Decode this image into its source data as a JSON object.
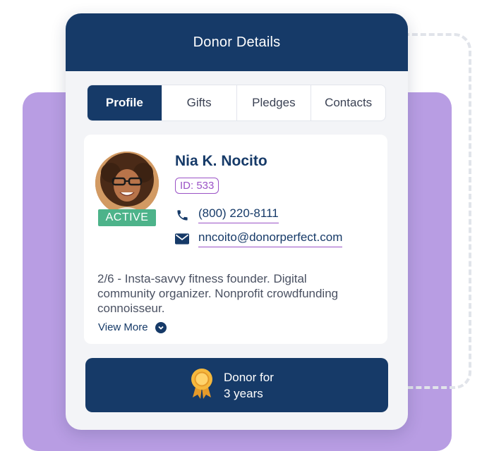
{
  "card": {
    "title": "Donor Details"
  },
  "tabs": [
    {
      "label": "Profile",
      "active": true
    },
    {
      "label": "Gifts"
    },
    {
      "label": "Pledges"
    },
    {
      "label": "Contacts"
    }
  ],
  "profile": {
    "name": "Nia K. Nocito",
    "id_label": "ID: 533",
    "status": "ACTIVE",
    "phone": "(800) 220-8111",
    "email": "nncoito@donorperfect.com",
    "bio": "2/6 - Insta-savvy fitness founder. Digital community organizer. Nonprofit crowdfunding connoisseur.",
    "view_more": "View More"
  },
  "tenure": {
    "line1": "Donor for",
    "line2": "3 years"
  },
  "icons": {
    "phone": "phone-icon",
    "email": "envelope-icon",
    "view_more": "chevron-down-icon",
    "tenure": "award-ribbon-icon"
  },
  "colors": {
    "primary_navy": "#163a68",
    "accent_purple": "#9a52c6",
    "background_purple": "#b89de3",
    "active_green": "#4db38a",
    "ribbon_gold": "#f5b83d"
  }
}
